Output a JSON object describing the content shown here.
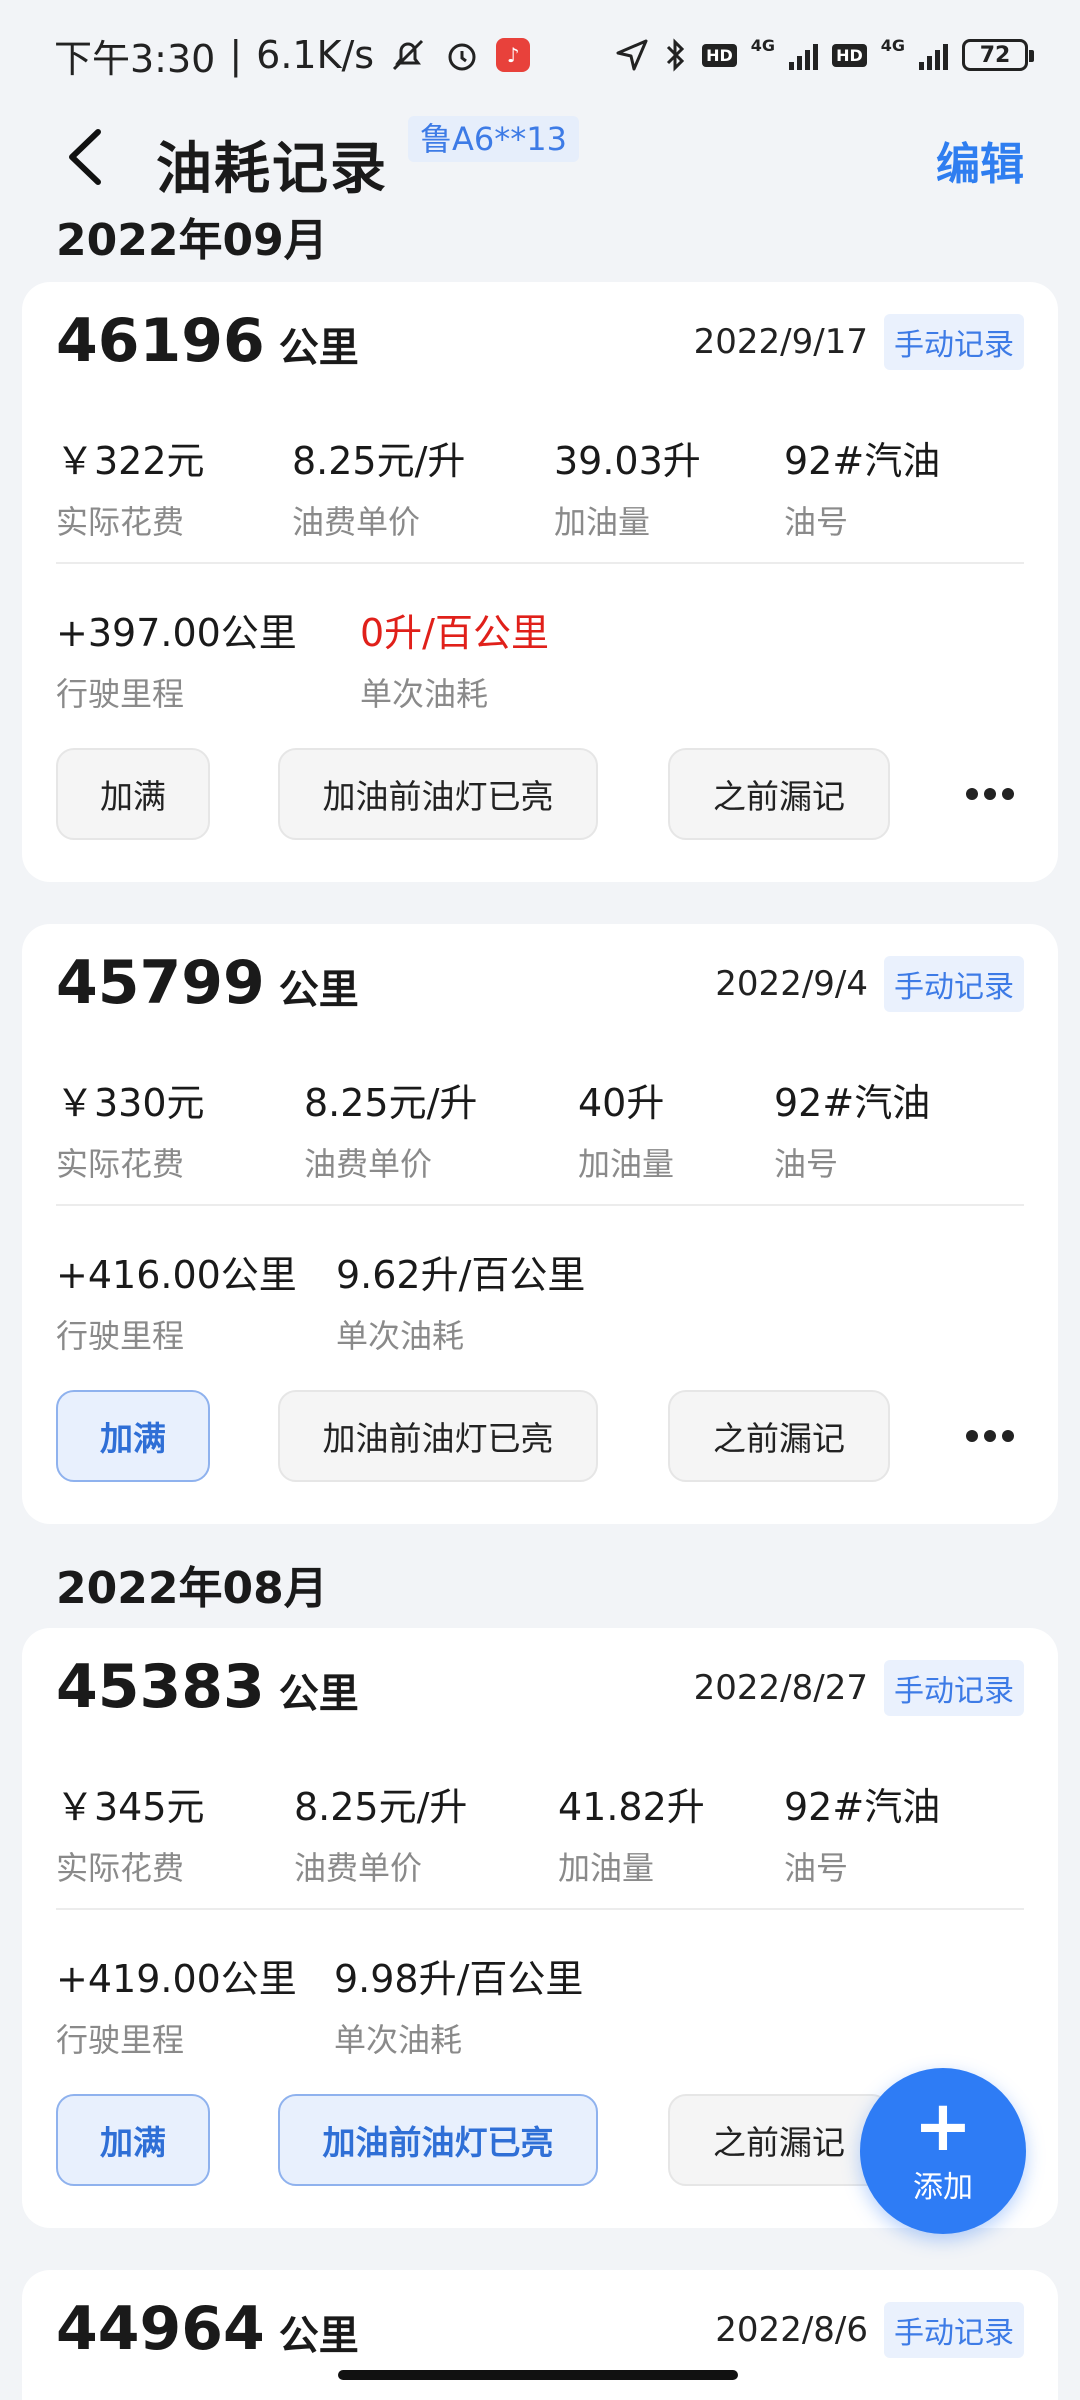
{
  "status_bar": {
    "time": "下午3:30",
    "speed": "6.1K/s",
    "hd": "HD",
    "net1": "4G",
    "net2": "4G",
    "battery": "72"
  },
  "header": {
    "title": "油耗记录",
    "plate": "鲁A6**13",
    "edit": "编辑"
  },
  "months": [
    "2022年09月",
    "2022年08月"
  ],
  "cards": [
    {
      "km": "46196",
      "unit": "公里",
      "date": "2022/9/17",
      "tag": "手动记录",
      "cost_v": "￥322元",
      "cost_l": "实际花费",
      "price_v": "8.25元/升",
      "price_l": "油费单价",
      "amount_v": "39.03升",
      "amount_l": "加油量",
      "fuel_v": "92#汽油",
      "fuel_l": "油号",
      "dist_v": "+397.00公里",
      "dist_l": "行驶里程",
      "cons_v": "0升/百公里",
      "cons_l": "单次油耗",
      "chips": [
        "加满",
        "加油前油灯已亮",
        "之前漏记"
      ]
    },
    {
      "km": "45799",
      "unit": "公里",
      "date": "2022/9/4",
      "tag": "手动记录",
      "cost_v": "￥330元",
      "cost_l": "实际花费",
      "price_v": "8.25元/升",
      "price_l": "油费单价",
      "amount_v": "40升",
      "amount_l": "加油量",
      "fuel_v": "92#汽油",
      "fuel_l": "油号",
      "dist_v": "+416.00公里",
      "dist_l": "行驶里程",
      "cons_v": "9.62升/百公里",
      "cons_l": "单次油耗",
      "chips": [
        "加满",
        "加油前油灯已亮",
        "之前漏记"
      ]
    },
    {
      "km": "45383",
      "unit": "公里",
      "date": "2022/8/27",
      "tag": "手动记录",
      "cost_v": "￥345元",
      "cost_l": "实际花费",
      "price_v": "8.25元/升",
      "price_l": "油费单价",
      "amount_v": "41.82升",
      "amount_l": "加油量",
      "fuel_v": "92#汽油",
      "fuel_l": "油号",
      "dist_v": "+419.00公里",
      "dist_l": "行驶里程",
      "cons_v": "9.98升/百公里",
      "cons_l": "单次油耗",
      "chips": [
        "加满",
        "加油前油灯已亮",
        "之前漏记"
      ]
    },
    {
      "km": "44964",
      "unit": "公里",
      "date": "2022/8/6",
      "tag": "手动记录"
    }
  ],
  "fab": {
    "label": "添加"
  }
}
